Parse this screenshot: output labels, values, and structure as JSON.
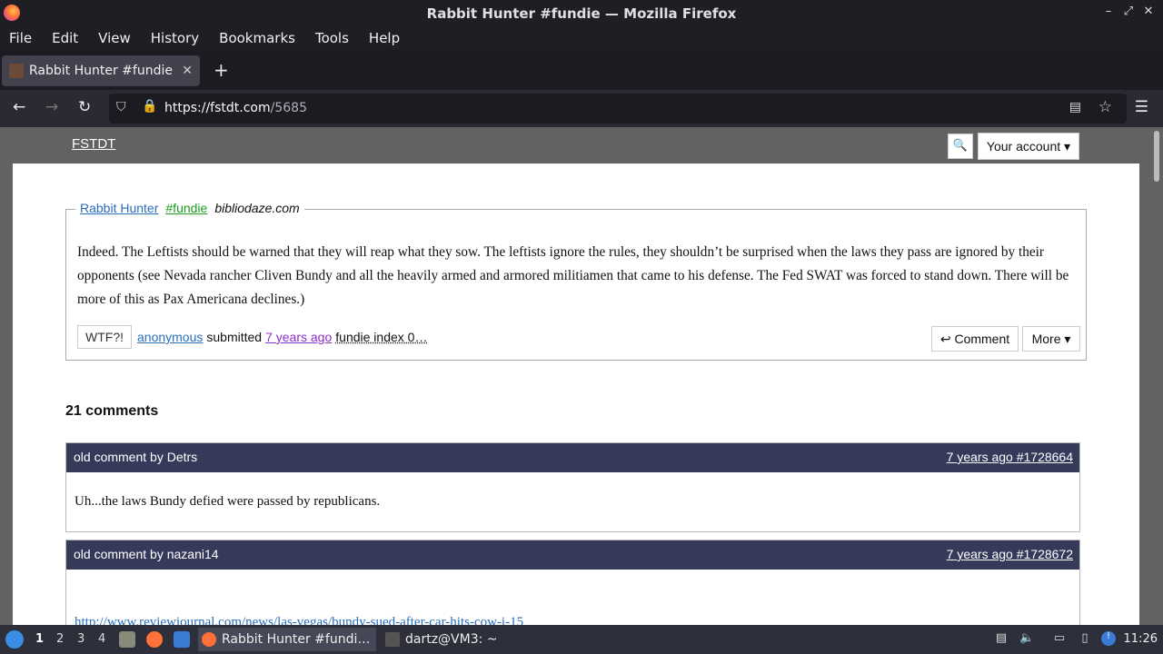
{
  "window": {
    "title": "Rabbit Hunter #fundie — Mozilla Firefox",
    "controls": [
      "–",
      "⤢",
      "✕"
    ]
  },
  "menu": [
    "File",
    "Edit",
    "View",
    "History",
    "Bookmarks",
    "Tools",
    "Help"
  ],
  "tab": {
    "title": "Rabbit Hunter #fundie",
    "close": "✕",
    "new_tab": "+"
  },
  "nav": {
    "url_domain": "https://fstdt.com",
    "url_path": "/5685"
  },
  "site": {
    "logo_link": "FSTDT",
    "search_icon": "🔍",
    "account_button": "Your account ▾"
  },
  "quote": {
    "author": "Rabbit Hunter",
    "tag": "#fundie",
    "source": "bibliodaze.com",
    "text": "Indeed. The Leftists should be warned that they will reap what they sow. The leftists ignore the rules, they shouldn’t be surprised when the laws they pass are ignored by their opponents (see Nevada rancher Cliven Bundy and all the heavily armed and armored militiamen that came to his defense. The Fed SWAT was forced to stand down. There will be more of this as Pax Americana declines.)",
    "wtf_button": "WTF?!",
    "submitter": "anonymous",
    "submitted_label": "submitted",
    "age": "7 years ago",
    "fundie_index": "fundie index 0…",
    "comment_button": "↩ Comment",
    "more_button": "More ▾"
  },
  "comments": {
    "heading": "21 comments",
    "items": [
      {
        "author": "old comment by Detrs",
        "link": "7 years ago #1728664",
        "body": "Uh...the laws Bundy defied were passed by republicans."
      },
      {
        "author": "old comment by nazani14",
        "link": "7 years ago #1728672",
        "body": "http://www.reviewjournal.com/news/las-vegas/bundy-sued-after-car-hits-cow-i-15"
      }
    ]
  },
  "taskbar": {
    "workspaces": [
      "1",
      "2",
      "3",
      "4"
    ],
    "tasks": [
      {
        "label": "Rabbit Hunter #fundi…",
        "active": true
      },
      {
        "label": "dartz@VM3: ~",
        "active": false
      }
    ],
    "clock": "11:26"
  },
  "colors": {
    "header_bar": "#363a5a",
    "link_blue": "#2a6ebb",
    "tag_green": "#1e9a1e",
    "visited_purple": "#8b2fc9",
    "page_gray": "#626262"
  }
}
